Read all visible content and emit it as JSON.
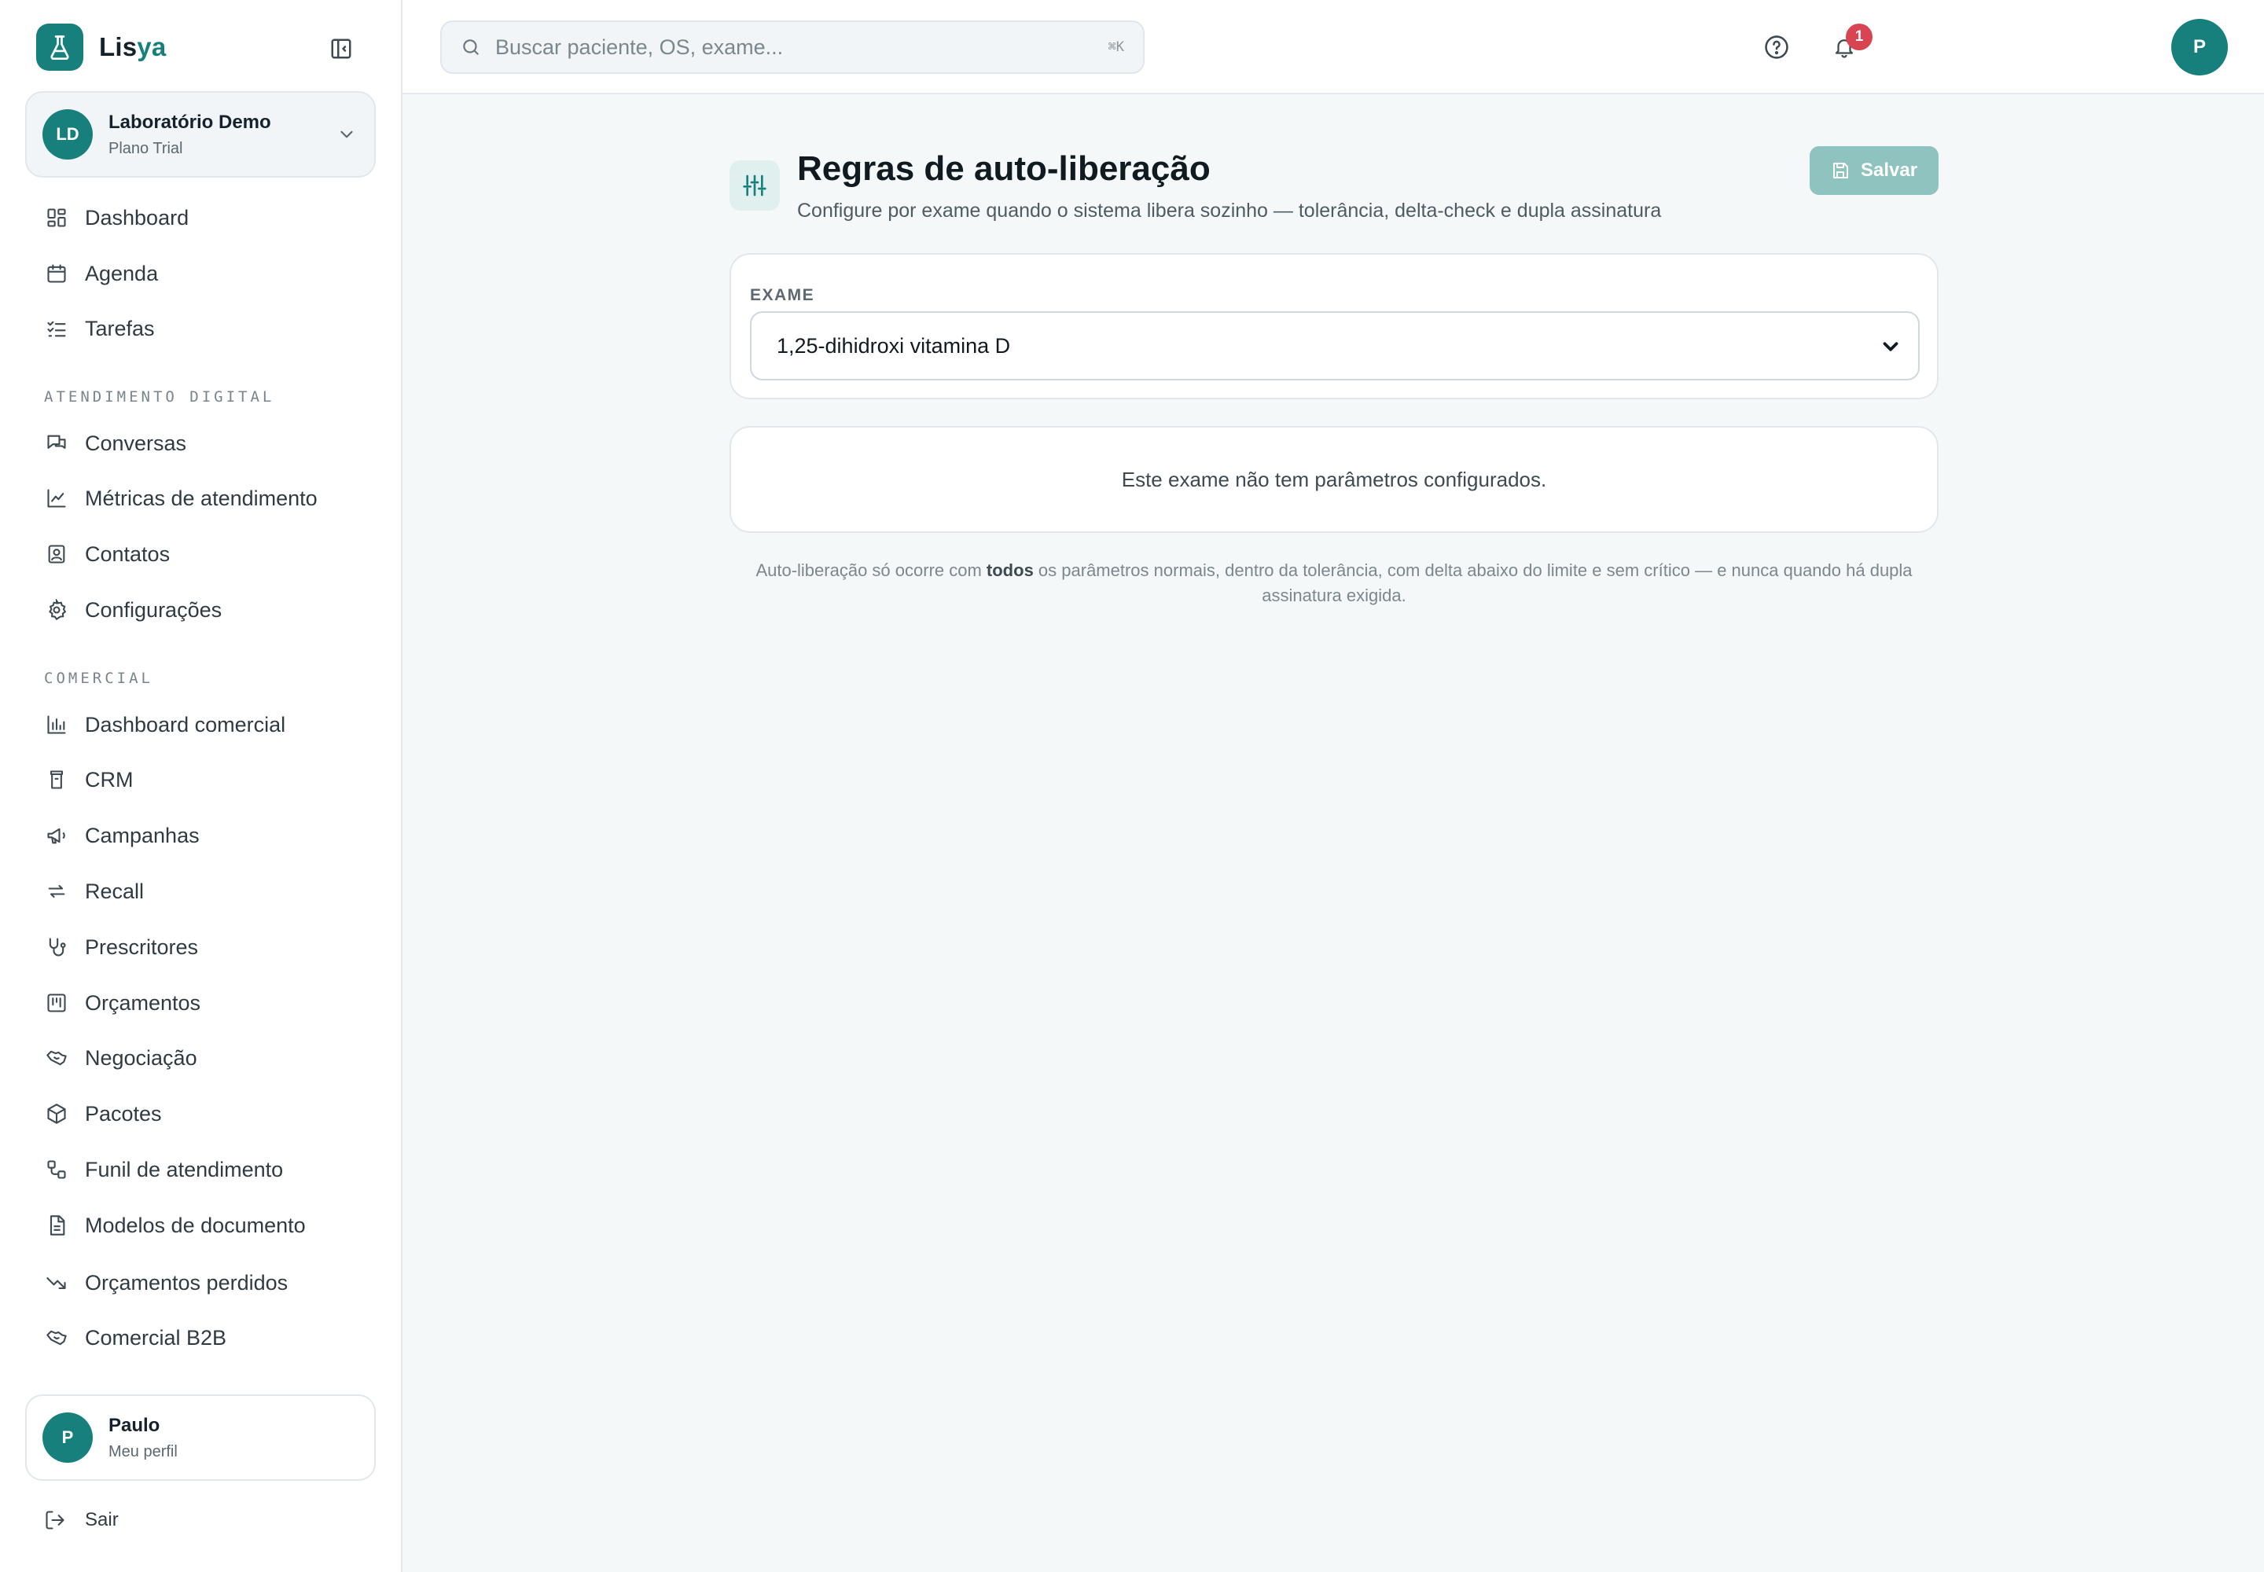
{
  "brand": {
    "name_part1": "Lis",
    "name_part2": "ya"
  },
  "org": {
    "initials": "LD",
    "name": "Laboratório Demo",
    "plan": "Plano Trial"
  },
  "nav": {
    "main": [
      {
        "label": "Dashboard",
        "icon": "dashboard-icon"
      },
      {
        "label": "Agenda",
        "icon": "calendar-icon"
      },
      {
        "label": "Tarefas",
        "icon": "tasks-icon"
      }
    ],
    "section_digital": "ATENDIMENTO DIGITAL",
    "digital": [
      {
        "label": "Conversas",
        "icon": "chat-icon"
      },
      {
        "label": "Métricas de atendimento",
        "icon": "line-chart-icon"
      },
      {
        "label": "Contatos",
        "icon": "contacts-icon"
      },
      {
        "label": "Configurações",
        "icon": "gear-icon"
      }
    ],
    "section_comercial": "COMERCIAL",
    "comercial": [
      {
        "label": "Dashboard comercial",
        "icon": "bar-chart-icon"
      },
      {
        "label": "CRM",
        "icon": "crm-icon"
      },
      {
        "label": "Campanhas",
        "icon": "megaphone-icon"
      },
      {
        "label": "Recall",
        "icon": "repeat-icon"
      },
      {
        "label": "Prescritores",
        "icon": "stethoscope-icon"
      },
      {
        "label": "Orçamentos",
        "icon": "budget-icon"
      },
      {
        "label": "Negociação",
        "icon": "handshake-icon"
      },
      {
        "label": "Pacotes",
        "icon": "package-icon"
      },
      {
        "label": "Funil de atendimento",
        "icon": "funnel-icon"
      },
      {
        "label": "Modelos de documento",
        "icon": "document-icon"
      },
      {
        "label": "Orçamentos perdidos",
        "icon": "trending-down-icon"
      },
      {
        "label": "Comercial B2B",
        "icon": "handshake-icon"
      }
    ]
  },
  "profile": {
    "initial": "P",
    "name": "Paulo",
    "subtitle": "Meu perfil"
  },
  "logout_label": "Sair",
  "search": {
    "placeholder": "Buscar paciente, OS, exame...",
    "shortcut": "⌘K"
  },
  "notifications": {
    "count": "1"
  },
  "user_initial": "P",
  "page": {
    "title": "Regras de auto-liberação",
    "subtitle": "Configure por exame quando o sistema libera sozinho — tolerância, delta-check e dupla assinatura",
    "save_label": "Salvar"
  },
  "exam_field": {
    "label": "EXAME",
    "selected": "1,25-dihidroxi vitamina D"
  },
  "empty_message": "Este exame não tem parâmetros configurados.",
  "footnote": {
    "part1": "Auto-liberação só ocorre com ",
    "bold": "todos",
    "part2": " os parâmetros normais, dentro da tolerância, com delta abaixo do limite e sem crítico — e nunca quando há dupla assinatura exigida."
  },
  "colors": {
    "accent": "#17807c",
    "badge": "#d94452",
    "save_disabled": "#8ec3c0"
  }
}
